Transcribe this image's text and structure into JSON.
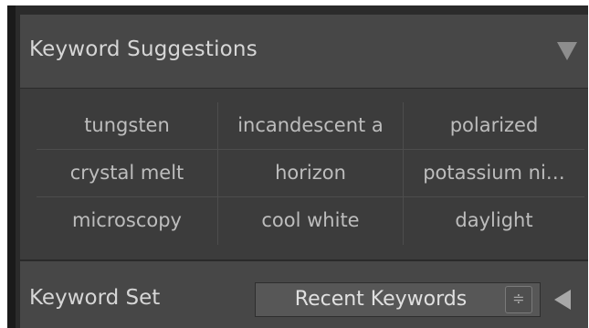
{
  "panel": {
    "title": "Keyword Suggestions",
    "collapse_icon": "triangle-down-icon"
  },
  "suggestions": [
    [
      "tungsten",
      "incandescent a",
      "polarized"
    ],
    [
      "crystal melt",
      "horizon",
      "potassium ni…"
    ],
    [
      "microscopy",
      "cool white",
      "daylight"
    ]
  ],
  "keyword_set": {
    "label": "Keyword Set",
    "selected": "Recent Keywords",
    "stepper_icon": "up-down-stepper-icon",
    "stepper_glyph": "≑",
    "expand_icon": "triangle-left-icon"
  },
  "colors": {
    "panel_bg": "#3c3c3c",
    "header_bg": "#474747",
    "text": "#d6d6d6",
    "cell_text": "#bdbdbd"
  }
}
